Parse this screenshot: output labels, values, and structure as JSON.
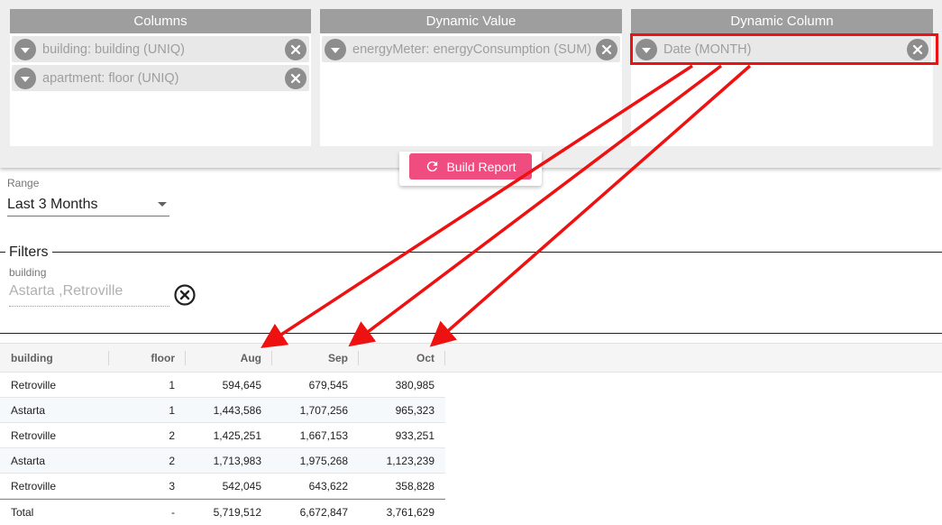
{
  "pivot": {
    "panels": [
      {
        "id": "columns",
        "title": "Columns",
        "chips": [
          "building: building (UNIQ)",
          "apartment: floor (UNIQ)"
        ]
      },
      {
        "id": "dynamic-value",
        "title": "Dynamic Value",
        "chips": [
          "energyMeter: energyConsumption (SUM)"
        ]
      },
      {
        "id": "dynamic-column",
        "title": "Dynamic Column",
        "chips": [
          "Date (MONTH)"
        ]
      }
    ],
    "build_label": "Build Report"
  },
  "range": {
    "label": "Range",
    "value": "Last 3 Months"
  },
  "filters": {
    "legend": "Filters",
    "field_label": "building",
    "values": "Astarta ,Retroville"
  },
  "table": {
    "headers": [
      "building",
      "floor",
      "Aug",
      "Sep",
      "Oct"
    ],
    "rows": [
      [
        "Retroville",
        "1",
        "594,645",
        "679,545",
        "380,985"
      ],
      [
        "Astarta",
        "1",
        "1,443,586",
        "1,707,256",
        "965,323"
      ],
      [
        "Retroville",
        "2",
        "1,425,251",
        "1,667,153",
        "933,251"
      ],
      [
        "Astarta",
        "2",
        "1,713,983",
        "1,975,268",
        "1,123,239"
      ],
      [
        "Retroville",
        "3",
        "542,045",
        "643,622",
        "358,828"
      ]
    ],
    "total": [
      "Total",
      "-",
      "5,719,512",
      "6,672,847",
      "3,761,629"
    ]
  },
  "colors": {
    "accent": "#ef4d80",
    "annotation": "#ee1111",
    "header_bg": "#9e9e9e"
  }
}
